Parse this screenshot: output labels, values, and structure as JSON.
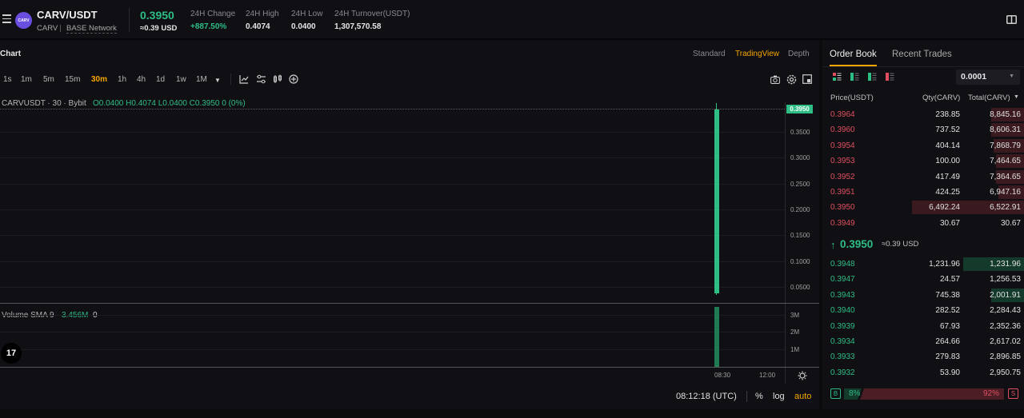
{
  "header": {
    "pair": "CARV/USDT",
    "base": "CARV",
    "network": "BASE Network",
    "logo_text": "CARV",
    "last_price": "0.3950",
    "last_price_usd": "≈0.39 USD",
    "change_label": "24H Change",
    "change_value": "+887.50%",
    "high_label": "24H High",
    "high_value": "0.4074",
    "low_label": "24H Low",
    "low_value": "0.0400",
    "turnover_label": "24H Turnover(USDT)",
    "turnover_value": "1,307,570.58"
  },
  "chart": {
    "title": "Chart",
    "views": [
      "Standard",
      "TradingView",
      "Depth"
    ],
    "active_view": "TradingView",
    "timeframes": [
      "1s",
      "1m",
      "5m",
      "15m",
      "30m",
      "1h",
      "4h",
      "1d",
      "1w",
      "1M"
    ],
    "active_timeframe": "30m",
    "symbol_info": "CARVUSDT · 30 · Bybit",
    "ohlc": "O0.0400  H0.4074  L0.0400  C0.3950  0 (0%)",
    "price_badge": "0.3950",
    "price_ticks": [
      "0.3500",
      "0.3000",
      "0.2500",
      "0.2000",
      "0.1500",
      "0.1000",
      "0.0500"
    ],
    "volume_label": "Volume SMA 9",
    "volume_value": "3.456M",
    "volume_suffix": "0",
    "volume_ticks": [
      "3M",
      "2M",
      "1M"
    ],
    "time_ticks": [
      "08:30",
      "12:00"
    ],
    "clock": "08:12:18 (UTC)",
    "scale_percent": "%",
    "scale_log": "log",
    "scale_auto": "auto",
    "tv_logo": "17",
    "colors": {
      "up": "#2ebd85",
      "down": "#e04f5f",
      "accent": "#f7a600"
    }
  },
  "orderbook": {
    "tabs": [
      "Order Book",
      "Recent Trades"
    ],
    "active_tab": "Order Book",
    "precision": "0.0001",
    "columns": [
      "Price(USDT)",
      "Qty(CARV)",
      "Total(CARV)"
    ],
    "asks": [
      {
        "price": "0.3964",
        "qty": "238.85",
        "total": "8,845.16",
        "depth": 0.29
      },
      {
        "price": "0.3960",
        "qty": "737.52",
        "total": "8,606.31",
        "depth": 0.29
      },
      {
        "price": "0.3954",
        "qty": "404.14",
        "total": "7,868.79",
        "depth": 0.27
      },
      {
        "price": "0.3953",
        "qty": "100.00",
        "total": "7,464.65",
        "depth": 0.25
      },
      {
        "price": "0.3952",
        "qty": "417.49",
        "total": "7,364.65",
        "depth": 0.25
      },
      {
        "price": "0.3951",
        "qty": "424.25",
        "total": "6,947.16",
        "depth": 0.23
      },
      {
        "price": "0.3950",
        "qty": "6,492.24",
        "total": "6,522.91",
        "depth": 1.0
      },
      {
        "price": "0.3949",
        "qty": "30.67",
        "total": "30.67",
        "depth": 0.0
      }
    ],
    "mid_price": "0.3950",
    "mid_usd": "≈0.39 USD",
    "bids": [
      {
        "price": "0.3948",
        "qty": "1,231.96",
        "total": "1,231.96",
        "depth": 0.54
      },
      {
        "price": "0.3947",
        "qty": "24.57",
        "total": "1,256.53",
        "depth": 0.0
      },
      {
        "price": "0.3943",
        "qty": "745.38",
        "total": "2,001.91",
        "depth": 0.29
      },
      {
        "price": "0.3940",
        "qty": "282.52",
        "total": "2,284.43",
        "depth": 0.0
      },
      {
        "price": "0.3939",
        "qty": "67.93",
        "total": "2,352.36",
        "depth": 0.0
      },
      {
        "price": "0.3934",
        "qty": "264.66",
        "total": "2,617.02",
        "depth": 0.0
      },
      {
        "price": "0.3933",
        "qty": "279.83",
        "total": "2,896.85",
        "depth": 0.0
      },
      {
        "price": "0.3932",
        "qty": "53.90",
        "total": "2,950.75",
        "depth": 0.0
      }
    ],
    "buy_label": "B",
    "buy_pct": "8%",
    "sell_pct": "92%",
    "sell_label": "S",
    "buy_ratio": 0.08
  }
}
